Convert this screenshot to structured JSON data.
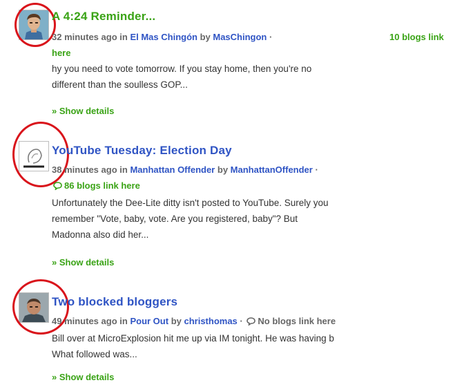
{
  "entries": [
    {
      "title": "A 4:24 Reminder...",
      "title_color": "#3aa316",
      "time": "32 minutes ago",
      "in_word": "in",
      "blog": "El Mas Chingón",
      "by_word": "by",
      "author": "MasChingon",
      "separator": "·",
      "links_line1": "10 blogs link",
      "links_line2": "here",
      "excerpt": [
        "hy you need to vote tomorrow. If you stay home, then you're no",
        "different than the soulless GOP..."
      ],
      "details": "» Show details",
      "avatar_icon": "person-avatar-icon"
    },
    {
      "title": "YouTube Tuesday: Election Day",
      "title_color": "#2f54c4",
      "time": "38 minutes ago",
      "in_word": "in",
      "blog": "Manhattan Offender",
      "by_word": "by",
      "author": "ManhattanOffender",
      "separator": "·",
      "links": "86 blogs link here",
      "excerpt": [
        "Unfortunately the Dee-Lite ditty isn't posted to YouTube. Surely you",
        "remember \"Vote, baby, vote. Are you registered, baby\"? But",
        "Madonna also did her..."
      ],
      "details": "» Show details",
      "avatar_icon": "sketch-avatar-icon"
    },
    {
      "title": "Two blocked bloggers",
      "title_color": "#2f54c4",
      "time": "49 minutes ago",
      "in_word": "in",
      "blog": "Pour Out",
      "by_word": "by",
      "author": "christhomas",
      "separator": "·",
      "links": "No blogs link here",
      "excerpt": [
        "Bill over at MicroExplosion hit me up via IM tonight.  He was having b",
        "What followed was..."
      ],
      "details": "» Show details",
      "avatar_icon": "photo-avatar-icon"
    }
  ],
  "colors": {
    "link_blue": "#2f54c4",
    "link_green": "#3aa316",
    "annotation_red": "#d9141b"
  }
}
